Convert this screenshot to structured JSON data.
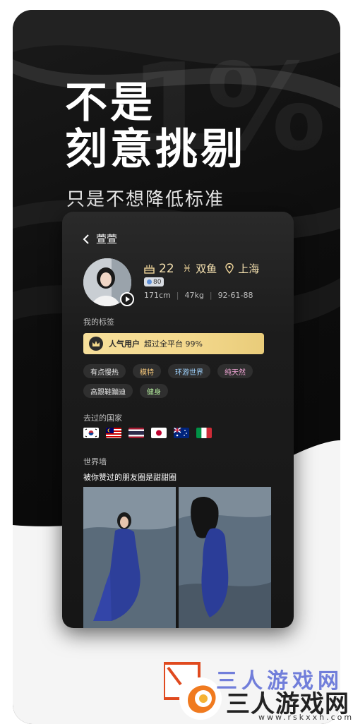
{
  "promo": {
    "headline_line1": "不是",
    "headline_line2": "刻意挑剔",
    "subline": "只是不想降低标准",
    "watermark": "1%"
  },
  "profile": {
    "name": "萱萱",
    "age": "22",
    "zodiac": "双鱼",
    "location": "上海",
    "level_badge": "80",
    "height": "171cm",
    "weight": "47kg",
    "measurements": "92-61-88"
  },
  "tags_section": {
    "label": "我的标签",
    "popular_title": "人气用户",
    "popular_desc": "超过全平台 99%",
    "tags": [
      "有点慢热",
      "模特",
      "环游世界",
      "纯天然",
      "高跟鞋蹦迪",
      "健身"
    ],
    "tag_colors": [
      "#e8e8e8",
      "#f5c77a",
      "#9fd3ff",
      "#f2a6d6",
      "#e8e8e8",
      "#b7f0a0"
    ]
  },
  "countries_section": {
    "label": "去过的国家",
    "flags": [
      "korea-flag-icon",
      "malaysia-flag-icon",
      "thailand-flag-icon",
      "japan-flag-icon",
      "australia-flag-icon",
      "italy-flag-icon"
    ]
  },
  "wall_section": {
    "label": "世界墙",
    "subtitle": "被你赞过的朋友圈是甜甜圈"
  },
  "watermark_site": {
    "name": "三人游戏网",
    "faded_name": "三人游戏网",
    "url": "www.rskxxh.com"
  },
  "colors": {
    "gold": "#f0d59a",
    "popular_bar": "#f3d88c",
    "background": "#0d0d0d"
  }
}
